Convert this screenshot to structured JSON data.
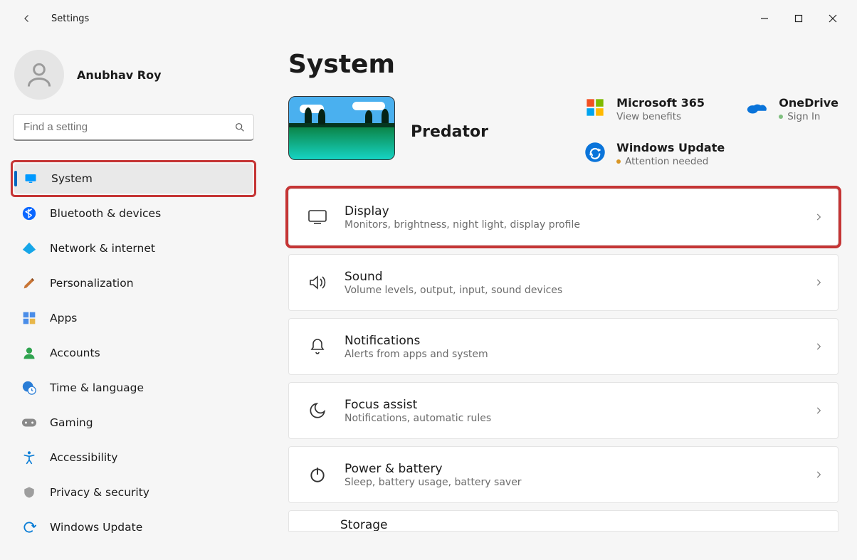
{
  "window": {
    "app_title": "Settings"
  },
  "user": {
    "name": "Anubhav Roy"
  },
  "search": {
    "placeholder": "Find a setting"
  },
  "page_title": "System",
  "pc": {
    "name": "Predator"
  },
  "sidebar": {
    "items": [
      {
        "id": "system",
        "label": "System",
        "icon": "display-icon",
        "active": true,
        "highlighted": true
      },
      {
        "id": "bluetooth",
        "label": "Bluetooth & devices",
        "icon": "bluetooth-icon"
      },
      {
        "id": "network",
        "label": "Network & internet",
        "icon": "wifi-icon"
      },
      {
        "id": "personalization",
        "label": "Personalization",
        "icon": "paintbrush-icon"
      },
      {
        "id": "apps",
        "label": "Apps",
        "icon": "apps-icon"
      },
      {
        "id": "accounts",
        "label": "Accounts",
        "icon": "person-icon"
      },
      {
        "id": "time",
        "label": "Time & language",
        "icon": "globe-clock-icon"
      },
      {
        "id": "gaming",
        "label": "Gaming",
        "icon": "gamepad-icon"
      },
      {
        "id": "accessibility",
        "label": "Accessibility",
        "icon": "accessibility-icon"
      },
      {
        "id": "privacy",
        "label": "Privacy & security",
        "icon": "shield-icon"
      },
      {
        "id": "update",
        "label": "Windows Update",
        "icon": "sync-icon"
      }
    ]
  },
  "hero_links": {
    "ms365": {
      "title": "Microsoft 365",
      "sub": "View benefits"
    },
    "onedrive": {
      "title": "OneDrive",
      "sub": "Sign In"
    },
    "update": {
      "title": "Windows Update",
      "sub": "Attention needed"
    }
  },
  "cards": [
    {
      "id": "display",
      "title": "Display",
      "sub": "Monitors, brightness, night light, display profile",
      "highlighted": true
    },
    {
      "id": "sound",
      "title": "Sound",
      "sub": "Volume levels, output, input, sound devices"
    },
    {
      "id": "notifications",
      "title": "Notifications",
      "sub": "Alerts from apps and system"
    },
    {
      "id": "focus",
      "title": "Focus assist",
      "sub": "Notifications, automatic rules"
    },
    {
      "id": "power",
      "title": "Power & battery",
      "sub": "Sleep, battery usage, battery saver"
    }
  ],
  "partial_card": {
    "title": "Storage"
  },
  "colors": {
    "accent": "#0067c0",
    "highlight": "#c53535"
  }
}
